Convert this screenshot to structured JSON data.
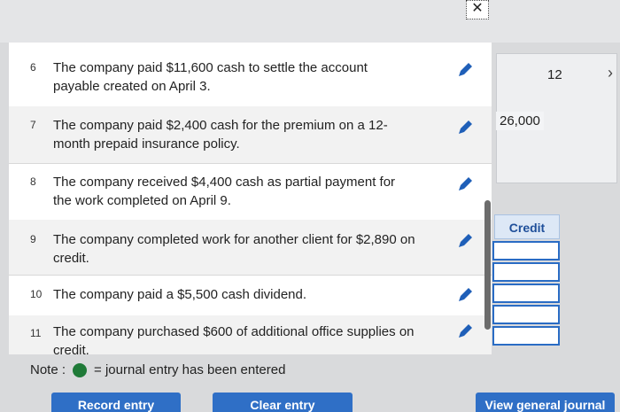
{
  "header": {
    "close_glyph": "✕"
  },
  "pager": {
    "page": "12",
    "next_glyph": "›"
  },
  "side": {
    "amount": "26,000",
    "credit_label": "Credit"
  },
  "transactions": [
    {
      "num": "6",
      "text": "The company paid $11,600 cash to settle the account payable created on April 3."
    },
    {
      "num": "7",
      "text": "The company paid $2,400 cash for the premium on a 12-month prepaid insurance policy."
    },
    {
      "num": "8",
      "text": "The company received $4,400 cash as partial payment for the work completed on April 9."
    },
    {
      "num": "9",
      "text": "The company completed work for another client for $2,890 on credit."
    },
    {
      "num": "10",
      "text": "The company paid a $5,500 cash dividend."
    },
    {
      "num": "11",
      "text": "The company purchased $600 of additional office supplies on credit."
    }
  ],
  "note": {
    "prefix": "Note :",
    "suffix": "= journal entry has been entered"
  },
  "buttons": {
    "record": "Record entry",
    "clear": "Clear entry",
    "view": "View general journal"
  },
  "colors": {
    "accent": "#2f6fc6",
    "entered_dot": "#1f7a38"
  }
}
